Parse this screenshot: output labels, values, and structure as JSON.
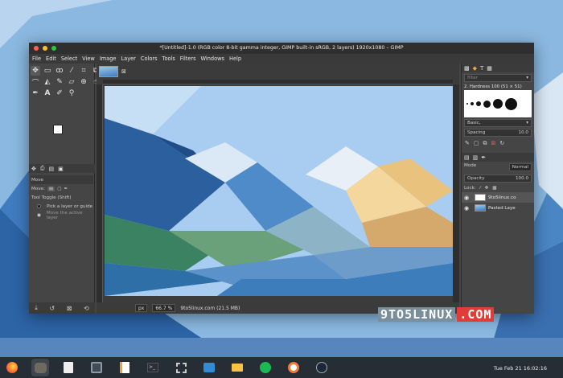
{
  "window": {
    "title": "*[Untitled]-1.0 (RGB color 8-bit gamma integer, GIMP built-in sRGB, 2 layers) 1920x1080 – GIMP",
    "controls": {
      "close_color": "#ff5f57",
      "minimize_color": "#febc2e",
      "maximize_color": "#28c840"
    }
  },
  "menu": [
    "File",
    "Edit",
    "Select",
    "View",
    "Image",
    "Layer",
    "Colors",
    "Tools",
    "Filters",
    "Windows",
    "Help"
  ],
  "toolbox": {
    "tools": [
      "move-icon",
      "rect-select-icon",
      "lasso-icon",
      "fuzzy-select-icon",
      "crop-icon",
      "transform-icon",
      "warp-icon",
      "bucket-fill-icon",
      "paintbrush-icon",
      "eraser-icon",
      "clone-icon",
      "smudge-icon",
      "path-icon",
      "text-icon",
      "color-picker-icon",
      "zoom-icon"
    ],
    "options": {
      "tool_name": "Move",
      "move_label": "Move:",
      "toggle_label": "Tool Toggle  (Shift)",
      "radio_1": "Pick a layer or guide",
      "radio_2": "Move the active layer"
    }
  },
  "status": {
    "unit": "px",
    "zoom": "66.7 %",
    "info": "9to5linux.com (21.5 MB)"
  },
  "dock": {
    "filter_placeholder": "filter",
    "brush_name": "2. Hardness 100 (51 × 51)",
    "brush_preset": "Basic,",
    "spacing_label": "Spacing",
    "spacing_value": "10.0",
    "mode_label": "Mode",
    "mode_value": "Normal",
    "opacity_label": "Opacity",
    "opacity_value": "100.0",
    "lock_label": "Lock:",
    "layers": [
      {
        "name": "9to5linux.co",
        "selected": true
      },
      {
        "name": "Pasted Laye",
        "selected": false
      }
    ]
  },
  "watermark": {
    "main": "9TO5LINUX",
    "tld": ".COM"
  },
  "taskbar": {
    "apps": [
      "firefox-icon",
      "gimp-icon",
      "files-icon",
      "calculator-icon",
      "text-editor-icon",
      "terminal-icon",
      "screenshot-icon",
      "software-center-icon",
      "mail-icon",
      "spotify-icon",
      "settings-icon",
      "steam-icon"
    ],
    "clock": "Tue Feb 21   16:02:16"
  }
}
